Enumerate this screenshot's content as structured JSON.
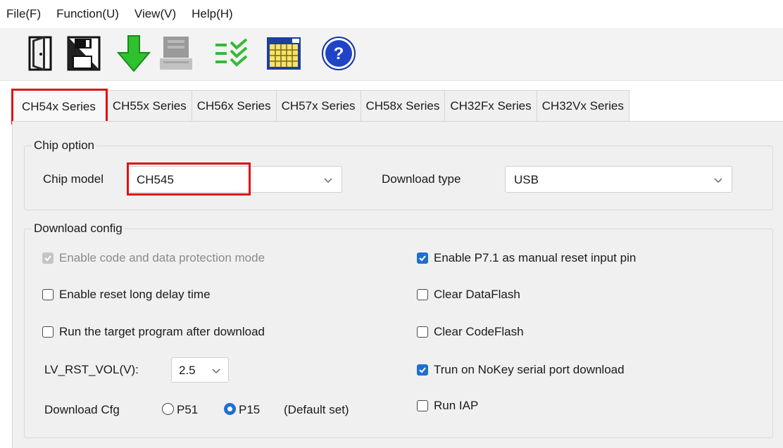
{
  "menu": [
    "File(F)",
    "Function(U)",
    "View(V)",
    "Help(H)"
  ],
  "toolbar": {
    "icons": [
      "open-file-icon",
      "save-icon",
      "download-arrow-icon",
      "stop-icon",
      "verify-icon",
      "calendar-icon",
      "help-icon"
    ],
    "help_glyph": "?"
  },
  "tabs": [
    "CH54x Series",
    "CH55x Series",
    "CH56x Series",
    "CH57x Series",
    "CH58x Series",
    "CH32Fx Series",
    "CH32Vx Series"
  ],
  "chip_option": {
    "title": "Chip option",
    "chip_model_label": "Chip model",
    "chip_model_value": "CH545",
    "download_type_label": "Download type",
    "download_type_value": "USB"
  },
  "download_config": {
    "title": "Download config",
    "checkboxes_left": [
      {
        "label": "Enable code and data protection mode",
        "checked": true,
        "disabled": true
      },
      {
        "label": "Enable reset long delay time",
        "checked": false,
        "disabled": false
      },
      {
        "label": "Run the target program after download",
        "checked": false,
        "disabled": false
      }
    ],
    "checkboxes_right": [
      {
        "label": "Enable P7.1 as manual reset input pin",
        "checked": true
      },
      {
        "label": "Clear DataFlash",
        "checked": false
      },
      {
        "label": "Clear CodeFlash",
        "checked": false
      },
      {
        "label": "Trun on NoKey serial port download",
        "checked": true
      },
      {
        "label": "Run IAP",
        "checked": false
      }
    ],
    "lv_rst_label": "LV_RST_VOL(V):",
    "lv_rst_value": "2.5",
    "download_cfg_label": "Download Cfg",
    "radio_p51": "P51",
    "radio_p15": "P15",
    "radio_selected": "P15",
    "default_set": "(Default set)"
  },
  "colors": {
    "highlight": "#e01111",
    "accent": "#1f6fd1"
  }
}
